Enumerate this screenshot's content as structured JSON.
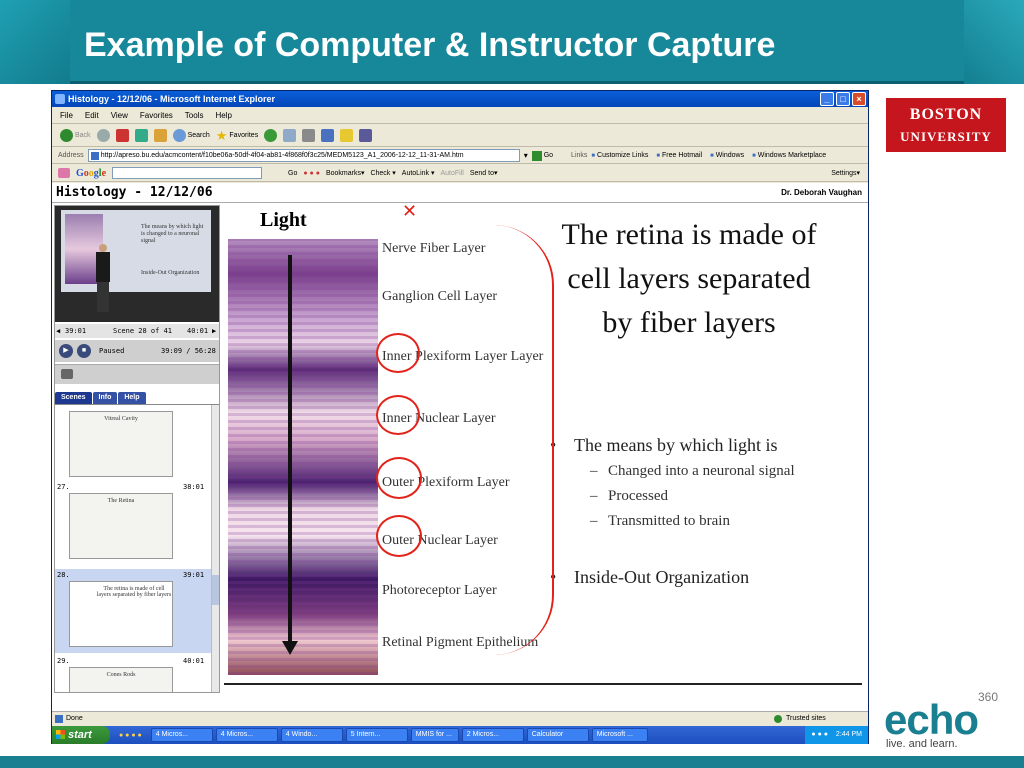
{
  "slide": {
    "title": "Example of Computer & Instructor Capture",
    "bu_logo_line1": "BOSTON",
    "bu_logo_line2": "UNIVERSITY",
    "echo_word": "echo",
    "echo_sup": "360",
    "echo_tagline": "live. and learn."
  },
  "ie": {
    "title": "Histology - 12/12/06 - Microsoft Internet Explorer",
    "menu": [
      "File",
      "Edit",
      "View",
      "Favorites",
      "Tools",
      "Help"
    ],
    "toolbar": {
      "back": "Back",
      "search": "Search",
      "favorites": "Favorites"
    },
    "address_label": "Address",
    "address_url": "http://apreso.bu.edu/acmcontent/f10be06a-50df-4f04-ab81-4f868f0f3c25/MEDM5123_A1_2006-12-12_11-31-AM.htm",
    "go": "Go",
    "links_label": "Links",
    "links": [
      "Customize Links",
      "Free Hotmail",
      "Windows",
      "Windows Marketplace"
    ],
    "google": {
      "go": "Go",
      "bookmarks": "Bookmarks▾",
      "check": "Check ▾",
      "autolink": "AutoLink ▾",
      "autofill": "AutoFill",
      "sendto": "Send to▾",
      "settings": "Settings▾"
    },
    "status_left": "Done",
    "status_right": "Trusted sites"
  },
  "lecture": {
    "title": "Histology - 12/12/06",
    "author": "Dr. Deborah Vaughan",
    "scene_time_left": "39:01",
    "scene_label": "Scene 28 of 41",
    "scene_time_right": "40:01",
    "play_state": "Paused",
    "play_time": "39:09 / 56:28",
    "tabs": [
      "Scenes",
      "Info",
      "Help"
    ],
    "scenes": [
      {
        "num": "",
        "time": "",
        "title": "Vitreal Cavity"
      },
      {
        "num": "27.",
        "time": "38:01",
        "title": "The Retina"
      },
      {
        "num": "28.",
        "time": "39:01",
        "title": "The retina is made of cell layers separated by fiber layers"
      },
      {
        "num": "29.",
        "time": "40:01",
        "title": "Cones        Rods"
      }
    ],
    "video_slide_text": "The means by which light is changed to a neuronal signal",
    "video_slide_text2": "Inside-Out Organization"
  },
  "main_slide": {
    "light_label": "Light",
    "layers": [
      "Nerve Fiber Layer",
      "Ganglion Cell Layer",
      "Inner Plexiform Layer Layer",
      "Inner Nuclear Layer",
      "Outer Plexiform Layer",
      "Outer Nuclear Layer",
      "Photoreceptor Layer",
      "Retinal Pigment Epithelium"
    ],
    "title_line1": "The retina is made of",
    "title_line2": "cell layers separated",
    "title_line3": "by fiber layers",
    "bullet1": "The means by which light is",
    "subs": [
      "Changed into a neuronal signal",
      "Processed",
      "Transmitted to brain"
    ],
    "bullet2": "Inside-Out Organization",
    "annot_x": "✕"
  },
  "taskbar": {
    "start": "start",
    "tasks": [
      "4 Micros...",
      "4 Micros...",
      "4 Windo...",
      "5 Intern...",
      "MMIS for ...",
      "2 Micros...",
      "Calculator",
      "Microsoft ..."
    ],
    "clock": "2:44 PM"
  },
  "colors": {
    "header_teal": "#17879a",
    "bu_red": "#c4161c",
    "annotation_red": "#e2231a"
  }
}
